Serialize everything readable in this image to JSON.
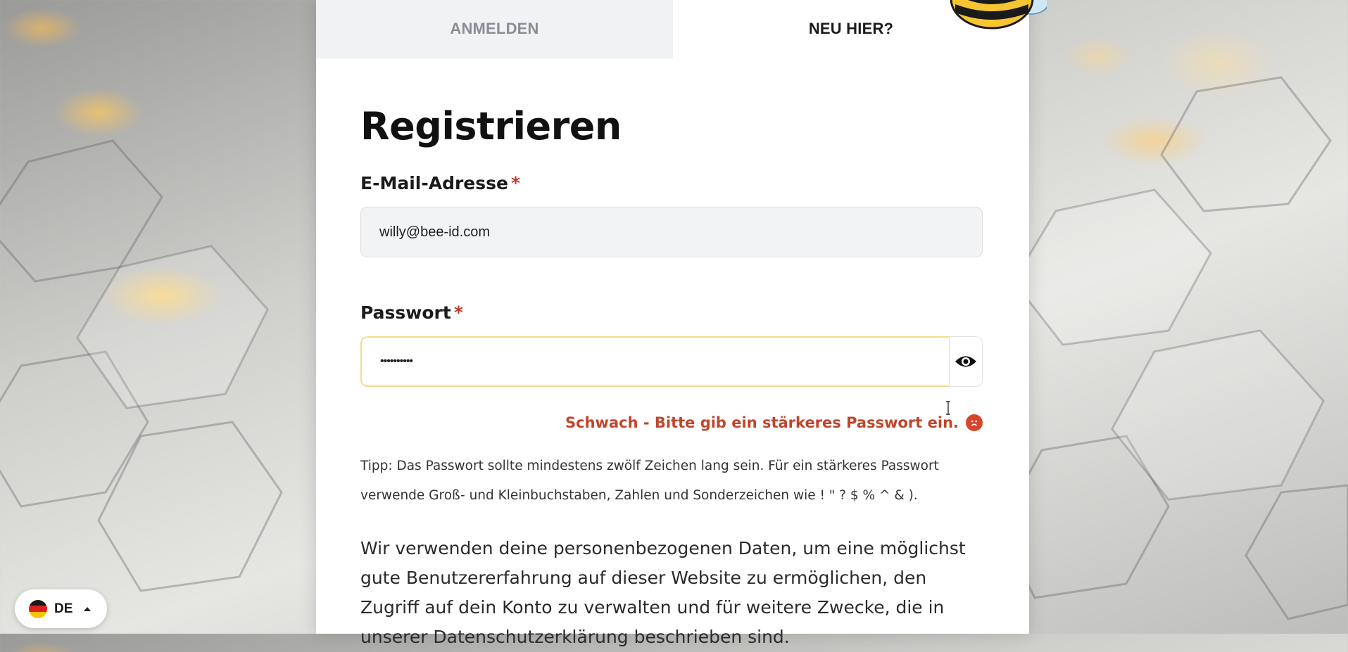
{
  "tabs": {
    "login": "ANMELDEN",
    "signup": "NEU HIER?"
  },
  "form": {
    "title": "Registrieren",
    "email_label": "E-Mail-Adresse",
    "required_mark": "*",
    "email_value": "willy@bee-id.com",
    "password_label": "Passwort",
    "password_value": "••••••••••",
    "strength_message": "Schwach - Bitte gib ein stärkeres Passwort ein.",
    "tip": "Tipp: Das Passwort sollte mindestens zwölf Zeichen lang sein. Für ein stärkeres Passwort verwende Groß- und Kleinbuchstaben, Zahlen und Sonderzeichen wie ! \" ? $ % ^ & ).",
    "privacy": "Wir verwenden deine personenbezogenen Daten, um eine möglichst gute Benutzererfahrung auf dieser Website zu ermöglichen, den Zugriff auf dein Konto zu verwalten und für weitere Zwecke, die in unserer Datenschutzerklärung beschrieben sind."
  },
  "language": {
    "code": "DE"
  },
  "icons": {
    "eye": "eye-icon",
    "sad": "sad-face-icon",
    "flag": "german-flag-icon",
    "mascot": "bee-mascot"
  },
  "colors": {
    "accent_error": "#c0452b",
    "focus_border": "#f2dc8c",
    "required": "#c0392b"
  }
}
